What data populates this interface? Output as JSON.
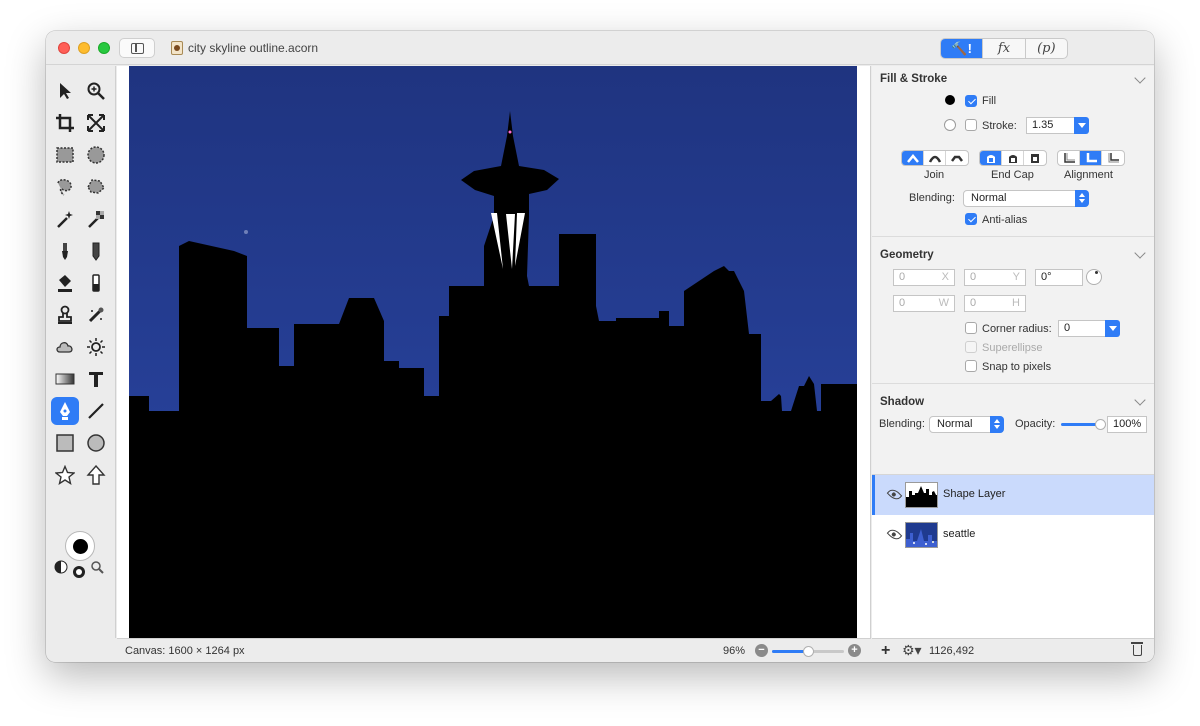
{
  "window": {
    "title": "city skyline outline.acorn",
    "segments": [
      {
        "label": "🔨!",
        "active": true
      },
      {
        "label": "fx",
        "active": false
      },
      {
        "label": "(p)",
        "active": false
      }
    ]
  },
  "toolbox": {
    "tools": [
      "select-arrow-icon",
      "zoom-icon",
      "crop-icon",
      "transform-icon",
      "rect-select-icon",
      "ellipse-select-icon",
      "lasso-icon",
      "polygon-lasso-icon",
      "magic-wand-icon",
      "instant-alpha-icon",
      "brush-icon",
      "pencil-icon",
      "fill-bucket-icon",
      "eraser-icon",
      "clone-stamp-icon",
      "retouch-icon",
      "cloud-icon",
      "sun-icon",
      "gradient-icon",
      "text-icon",
      "pen-icon",
      "line-icon",
      "rectangle-icon",
      "circle-icon",
      "star-icon",
      "arrow-icon"
    ],
    "active_tool": "pen-icon",
    "fill_color": "#000000"
  },
  "canvas": {
    "sky_color": "#24409a",
    "status_text": "Canvas: 1600 × 1264 px",
    "zoom_text": "96%",
    "zoom_level": 0.5
  },
  "fill_stroke": {
    "title": "Fill & Stroke",
    "fill_label": "Fill",
    "fill_checked": true,
    "stroke_label": "Stroke:",
    "stroke_checked": false,
    "stroke_width": "1.35",
    "join_label": "Join",
    "endcap_label": "End Cap",
    "alignment_label": "Alignment",
    "blending_label": "Blending:",
    "blending_value": "Normal",
    "antialias_label": "Anti-alias",
    "antialias_checked": true
  },
  "geometry": {
    "title": "Geometry",
    "x_value": "0",
    "x_suffix": "X",
    "y_value": "0",
    "y_suffix": "Y",
    "rotation": "0°",
    "w_value": "0",
    "w_suffix": "W",
    "h_value": "0",
    "h_suffix": "H",
    "corner_radius_label": "Corner radius:",
    "corner_radius_value": "0",
    "superellipse_label": "Superellipse",
    "snap_label": "Snap to pixels"
  },
  "shadow": {
    "title": "Shadow",
    "blending_label": "Blending:",
    "blending_value": "Normal",
    "opacity_label": "Opacity:",
    "opacity_value": "100%",
    "opacity_level": 1.0
  },
  "layers": [
    {
      "name": "Shape Layer",
      "selected": true
    },
    {
      "name": "seattle",
      "selected": false
    }
  ],
  "footer": {
    "coords": "1126,492"
  }
}
